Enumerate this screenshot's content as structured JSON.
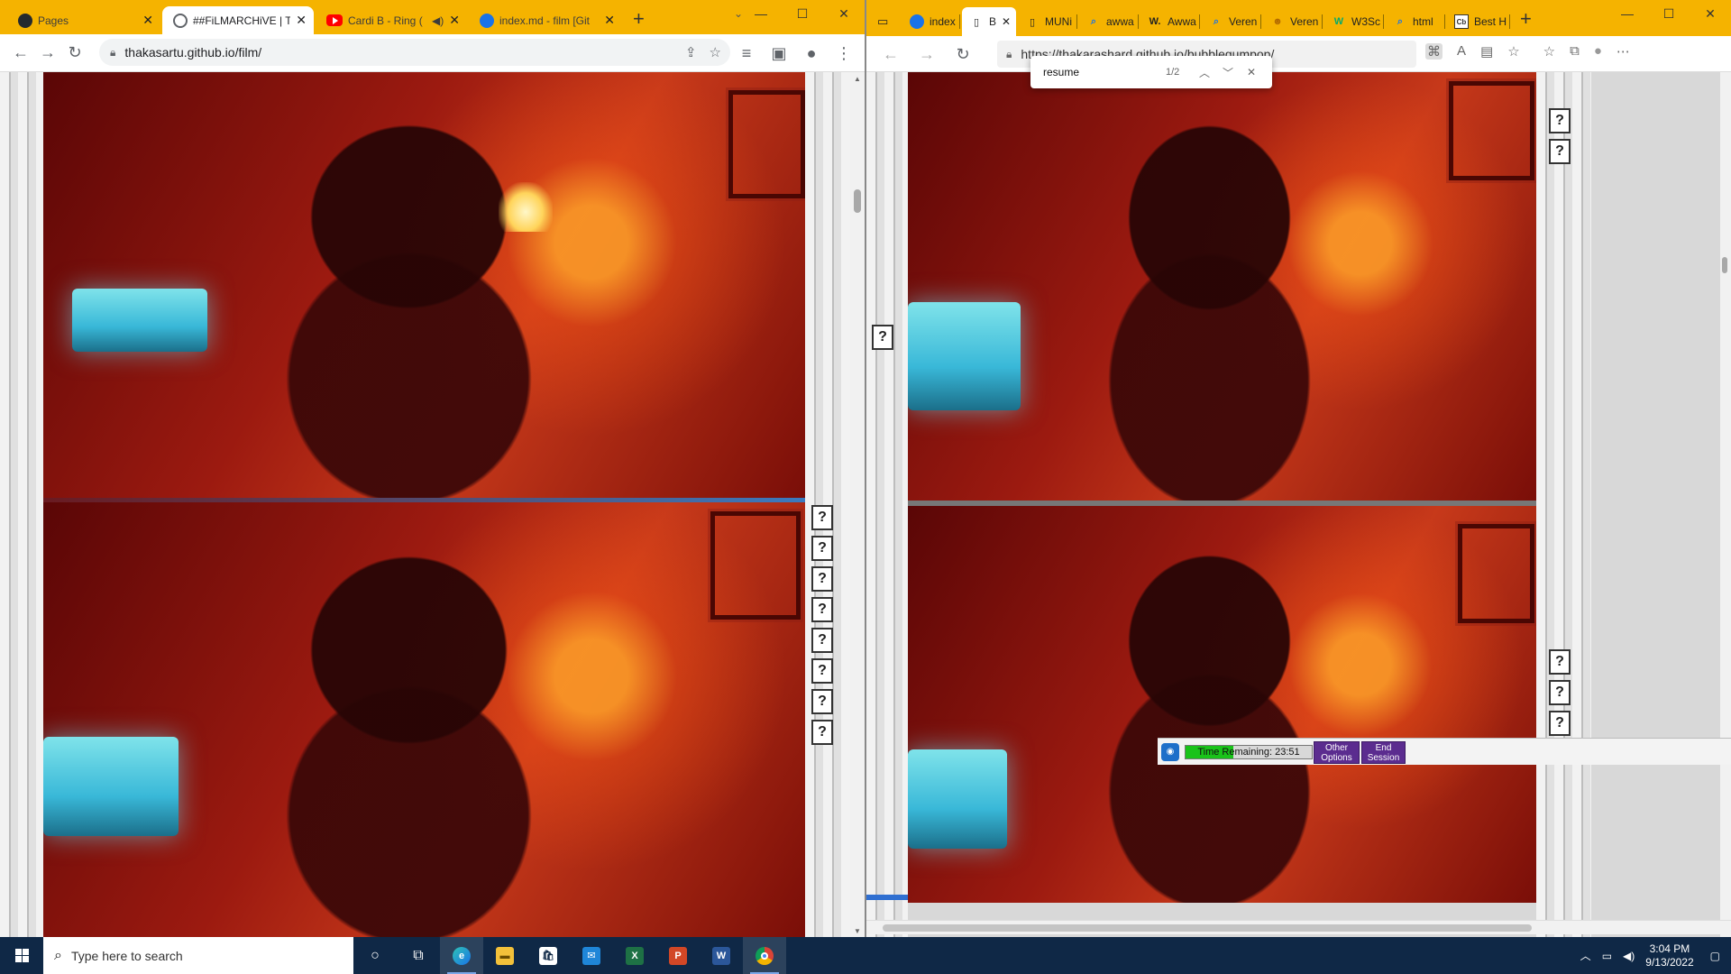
{
  "left_browser": {
    "tabs": [
      {
        "title": "Pages",
        "favicon": "github-icon"
      },
      {
        "title": "##FiLMARCHiVE | Th",
        "favicon": "globe-icon",
        "active": true
      },
      {
        "title": "Cardi B - Ring (",
        "favicon": "youtube-icon",
        "audio": true
      },
      {
        "title": "index.md - film [Git",
        "favicon": "github-icon"
      }
    ],
    "url": "thakasartu.github.io/film/"
  },
  "right_browser": {
    "tabs": [
      {
        "title": "index",
        "favicon": "github-icon"
      },
      {
        "title": "B",
        "favicon": "page-icon",
        "active": true
      },
      {
        "title": "MUNi",
        "favicon": "page-icon"
      },
      {
        "title": "awwa",
        "favicon": "search-icon"
      },
      {
        "title": "Awwa",
        "favicon": "w-icon"
      },
      {
        "title": "Veren",
        "favicon": "search-icon"
      },
      {
        "title": "Veren",
        "favicon": "face-icon"
      },
      {
        "title": "W3Sc",
        "favicon": "w3-icon"
      },
      {
        "title": "html",
        "favicon": "search-icon"
      },
      {
        "title": "Best H",
        "favicon": "cb-icon"
      }
    ],
    "url": "https://thakarashard.github.io/bubblegumpop/",
    "find": {
      "query": "resume",
      "count": "1/2"
    }
  },
  "session": {
    "timer_label": "Time Remaining: 23:51",
    "timer_fill": 0.38,
    "other_options": "Other Options",
    "end_session": "End Session"
  },
  "taskbar": {
    "search_placeholder": "Type here to search",
    "time": "3:04 PM",
    "date": "9/13/2022"
  },
  "colors": {
    "tabstrip": "#f5b300",
    "taskbar": "#0f2846",
    "session_button": "#5b2c8f",
    "timer_fill": "#19c319"
  }
}
